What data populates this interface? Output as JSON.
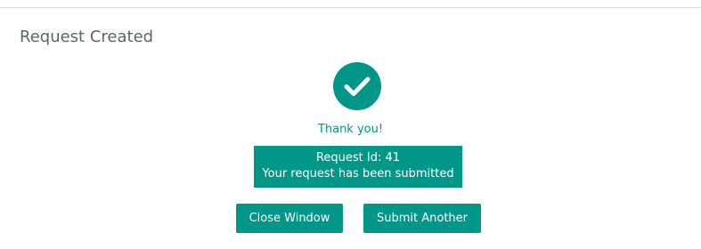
{
  "header": {
    "title": "Request Created"
  },
  "confirmation": {
    "icon": "check-circle-icon",
    "thanks_text": "Thank you!",
    "request_id_text": "Request Id: 41",
    "status_text": "Your request has been submitted"
  },
  "actions": {
    "close_label": "Close Window",
    "submit_another_label": "Submit Another"
  },
  "colors": {
    "accent": "#009688",
    "header_text": "#5f6368",
    "divider": "#d9d9d9"
  }
}
